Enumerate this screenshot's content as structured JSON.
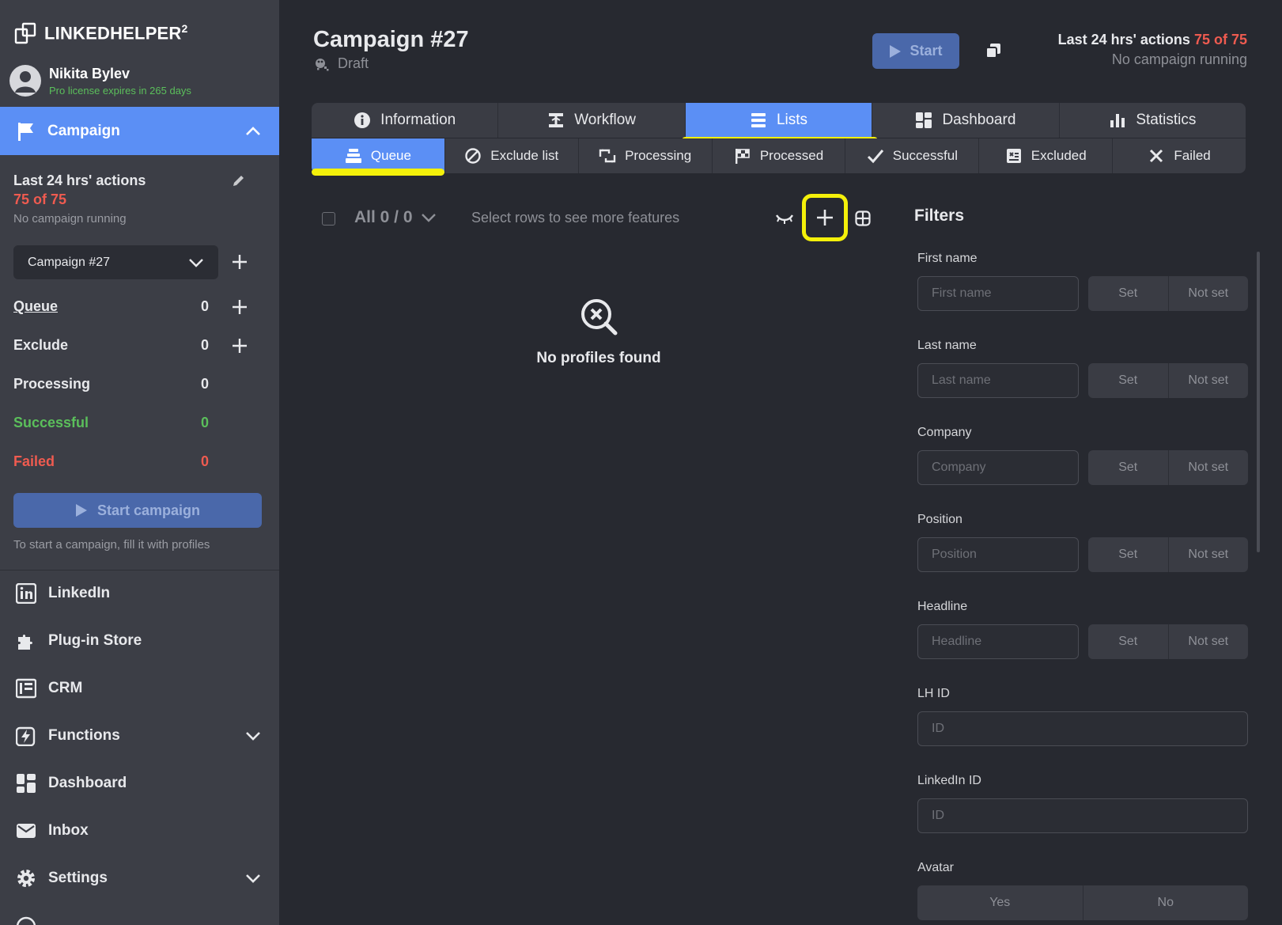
{
  "brand": {
    "name": "LINKEDHELPER",
    "superscript": "2"
  },
  "user": {
    "name": "Nikita Bylev",
    "license": "Pro license expires in 265 days"
  },
  "sidebar": {
    "campaign_label": "Campaign",
    "actions_title": "Last 24 hrs' actions",
    "actions_count": "75 of 75",
    "actions_status": "No campaign running",
    "campaign_select": "Campaign #27",
    "counts": [
      {
        "label": "Queue",
        "value": "0"
      },
      {
        "label": "Exclude",
        "value": "0"
      },
      {
        "label": "Processing",
        "value": "0"
      },
      {
        "label": "Successful",
        "value": "0"
      },
      {
        "label": "Failed",
        "value": "0"
      }
    ],
    "start_campaign": "Start campaign",
    "start_hint": "To start a campaign, fill it with profiles",
    "nav": [
      {
        "label": "LinkedIn"
      },
      {
        "label": "Plug-in Store"
      },
      {
        "label": "CRM"
      },
      {
        "label": "Functions"
      },
      {
        "label": "Dashboard"
      },
      {
        "label": "Inbox"
      },
      {
        "label": "Settings"
      }
    ]
  },
  "header": {
    "title": "Campaign #27",
    "status": "Draft",
    "start_label": "Start",
    "actions_prefix": "Last 24 hrs' actions",
    "actions_count": "75 of 75",
    "running_status": "No campaign running"
  },
  "tabs": [
    {
      "label": "Information"
    },
    {
      "label": "Workflow"
    },
    {
      "label": "Lists"
    },
    {
      "label": "Dashboard"
    },
    {
      "label": "Statistics"
    }
  ],
  "subtabs": [
    {
      "label": "Queue"
    },
    {
      "label": "Exclude list"
    },
    {
      "label": "Processing"
    },
    {
      "label": "Processed"
    },
    {
      "label": "Successful"
    },
    {
      "label": "Excluded"
    },
    {
      "label": "Failed"
    }
  ],
  "toolbar": {
    "all_count": "All 0 / 0",
    "select_hint": "Select rows to see more features"
  },
  "empty_state": {
    "text": "No profiles found"
  },
  "filters": {
    "title": "Filters",
    "fields": [
      {
        "label": "First name",
        "placeholder": "First name"
      },
      {
        "label": "Last name",
        "placeholder": "Last name"
      },
      {
        "label": "Company",
        "placeholder": "Company"
      },
      {
        "label": "Position",
        "placeholder": "Position"
      },
      {
        "label": "Headline",
        "placeholder": "Headline"
      }
    ],
    "set_label": "Set",
    "not_set_label": "Not set",
    "lh_id": {
      "label": "LH ID",
      "placeholder": "ID"
    },
    "linkedin_id": {
      "label": "LinkedIn ID",
      "placeholder": "ID"
    },
    "avatar": {
      "label": "Avatar",
      "yes": "Yes",
      "no": "No"
    }
  },
  "colors": {
    "accent": "#5b8ff5",
    "danger": "#ef5b50",
    "success": "#5bbf5b",
    "highlight": "#f4f00a",
    "background": "#272930",
    "sidebar": "#3c3e46"
  }
}
